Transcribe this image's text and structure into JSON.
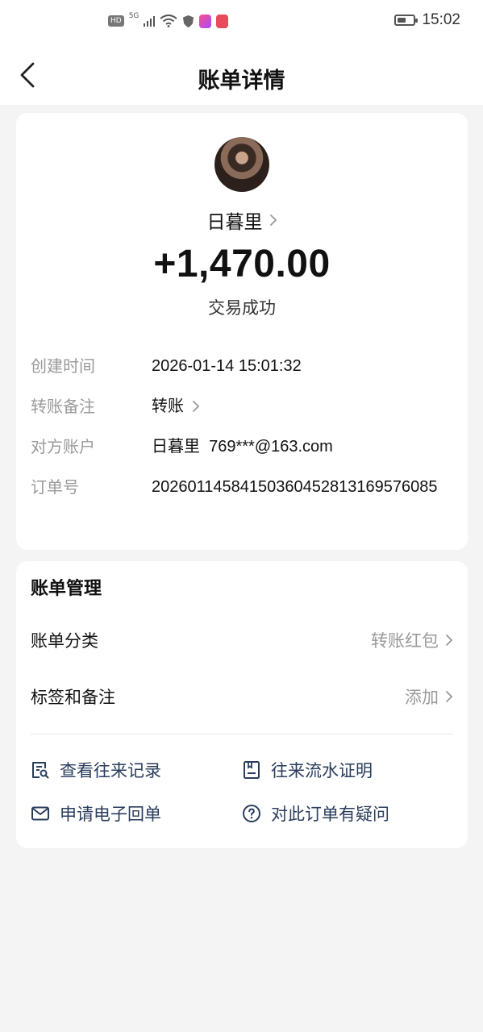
{
  "status_bar": {
    "hd": "HD",
    "network": "5G",
    "time": "15:02",
    "battery_level": 0.55
  },
  "nav": {
    "title": "账单详情"
  },
  "transaction": {
    "payer_name": "日暮里",
    "amount": "+1,470.00",
    "status": "交易成功",
    "details": [
      {
        "label": "创建时间",
        "value": "2026-01-14 15:01:32"
      },
      {
        "label": "转账备注",
        "value": "转账"
      },
      {
        "label": "对方账户",
        "value": "日暮里  769***@163.com"
      },
      {
        "label": "订单号",
        "value": "2026011458415036045281316957​6085"
      }
    ]
  },
  "management": {
    "title": "账单管理",
    "category_label": "账单分类",
    "category_value": "转账红包",
    "tag_label": "标签和备注",
    "tag_value": "添加",
    "actions": [
      {
        "label": "查看往来记录",
        "icon": "record-search-icon"
      },
      {
        "label": "往来流水证明",
        "icon": "statement-icon"
      },
      {
        "label": "申请电子回单",
        "icon": "mail-icon"
      },
      {
        "label": "对此订单有疑问",
        "icon": "question-icon"
      }
    ]
  },
  "colors": {
    "background": "#f4f4f4",
    "card": "#ffffff",
    "action_text": "#2a3d5c",
    "muted": "#9a9a9a"
  }
}
